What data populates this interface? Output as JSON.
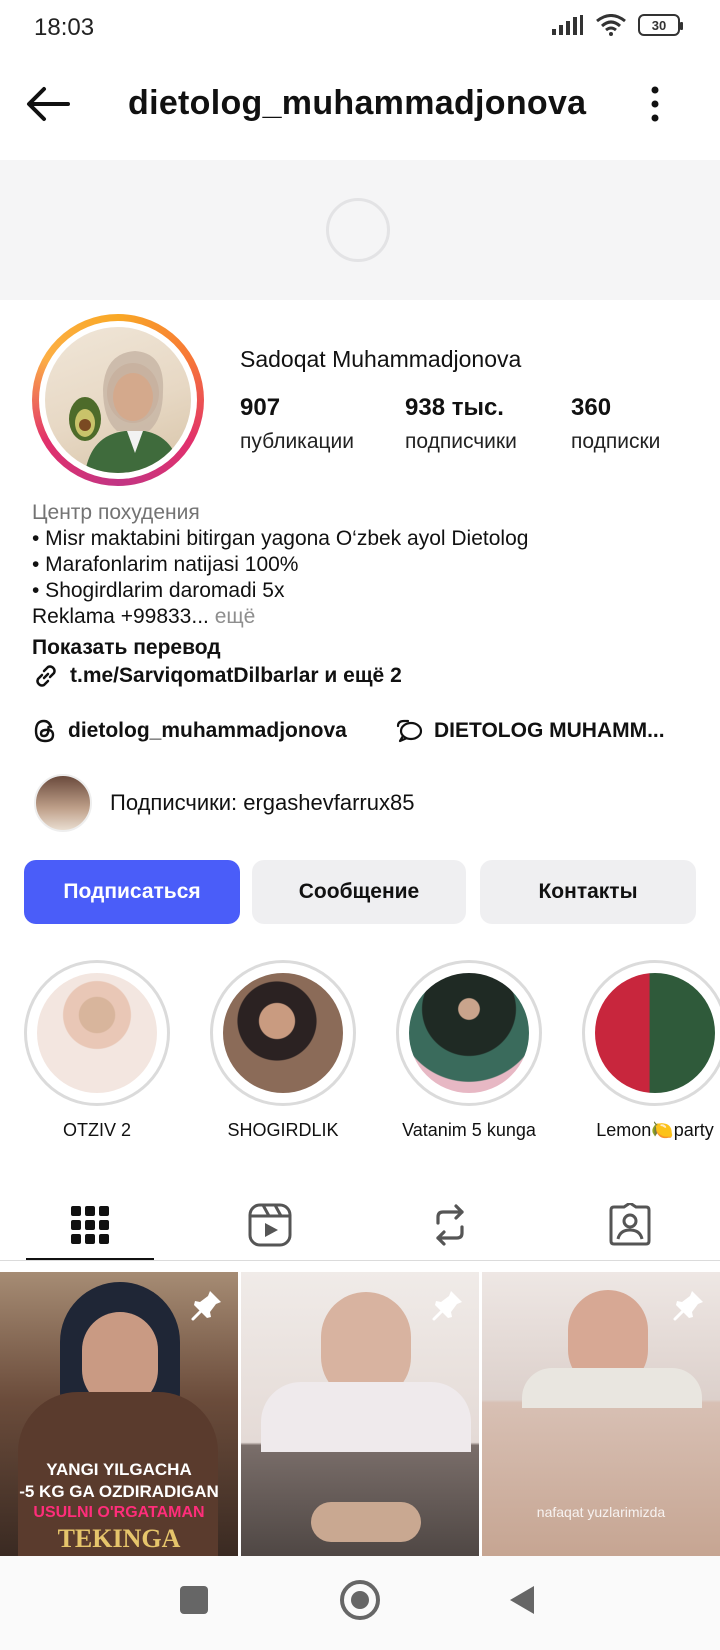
{
  "status": {
    "time": "18:03",
    "battery": "30"
  },
  "header": {
    "username": "dietolog_muhammadjonova"
  },
  "profile": {
    "name": "Sadoqat Muhammadjonova",
    "stats": [
      {
        "value": "907",
        "label": "публикации"
      },
      {
        "value": "938 тыс.",
        "label": "подписчики"
      },
      {
        "value": "360",
        "label": "подписки"
      }
    ],
    "category": "Центр похудения",
    "bio_lines": [
      "• Misr maktabini bitirgan yagona O‘zbek ayol Dietolog",
      "• Marafonlarim natijasi 100%",
      "• Shogirdlarim daromadi 5x"
    ],
    "bio_tail": "Reklama +99833...",
    "more": " ещё",
    "translate": "Показать перевод",
    "link": "t.me/SarviqomatDilbarlar и ещё 2",
    "threads": "dietolog_muhammadjonova",
    "channel": "DIETOLOG MUHAMM...",
    "followers_prefix": "Подписчики: ",
    "followers_user": "ergashevfarrux85"
  },
  "buttons": {
    "follow": "Подписаться",
    "message": "Сообщение",
    "contacts": "Контакты"
  },
  "highlights": [
    {
      "label": "OTZIV 2"
    },
    {
      "label": "SHOGIRDLIK"
    },
    {
      "label": "Vatanim 5 kunga"
    },
    {
      "label": "Lemon🍋party"
    }
  ],
  "posts": [
    {
      "line1": "YANGI YILGACHA",
      "line2": "-5 KG GA OZDIRADIGAN",
      "line3": "USULNI O'RGATAMAN",
      "line4": "TEKINGA"
    },
    {},
    {
      "caption": "nafaqat yuzlarimizda"
    }
  ],
  "colors": {
    "accent": "#4a5df9",
    "secondary_button": "#efeff1"
  }
}
